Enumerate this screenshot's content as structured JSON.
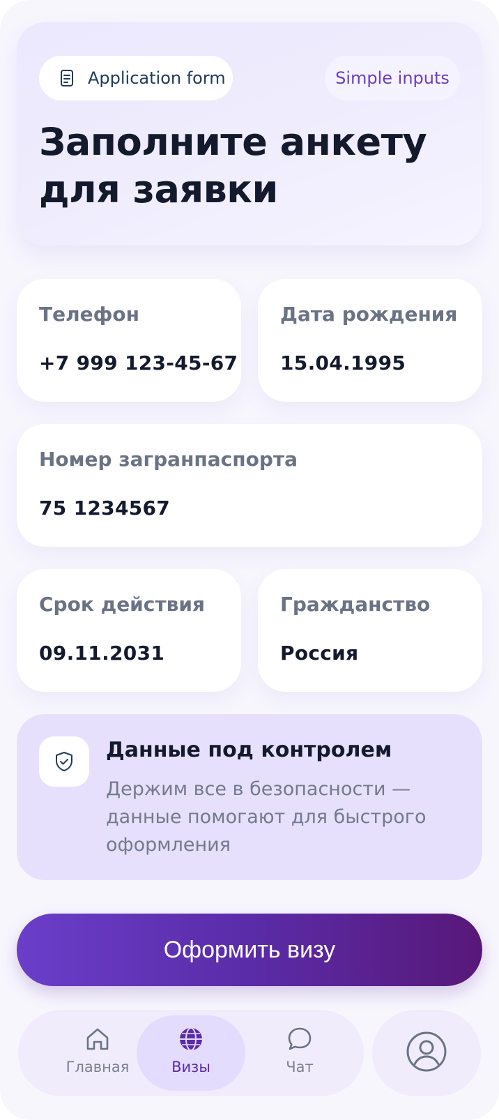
{
  "header": {
    "form_pill_label": "Application form",
    "simple_pill_label": "Simple inputs",
    "title": "Заполните анкету для заявки"
  },
  "fields": {
    "phone": {
      "label": "Телефон",
      "value": "+7 999 123-45-67"
    },
    "birth_date": {
      "label": "Дата рождения",
      "value": "15.04.1995"
    },
    "passport": {
      "label": "Номер загранпаспорта",
      "value": "75 1234567"
    },
    "expiry": {
      "label": "Срок действия",
      "value": "09.11.2031"
    },
    "citizenship": {
      "label": "Гражданство",
      "value": "Россия"
    }
  },
  "info": {
    "title": "Данные под контролем",
    "text": "Держим все в безопасности — данные помогают для быстрого оформления",
    "icon": "shield-check-icon"
  },
  "cta": {
    "label": "Оформить визу"
  },
  "nav": {
    "items": [
      {
        "label": "Главная",
        "icon": "home-icon",
        "active": false
      },
      {
        "label": "Визы",
        "icon": "globe-icon",
        "active": true
      },
      {
        "label": "Чат",
        "icon": "chat-bubble-icon",
        "active": false
      }
    ],
    "profile_icon": "user-avatar-icon"
  },
  "colors": {
    "accent": "#5a2ca8",
    "cta_gradient_start": "#6a3ec9",
    "cta_gradient_end": "#581878",
    "info_card_bg": "#e7e0fd",
    "background": "#f7f6fd"
  }
}
